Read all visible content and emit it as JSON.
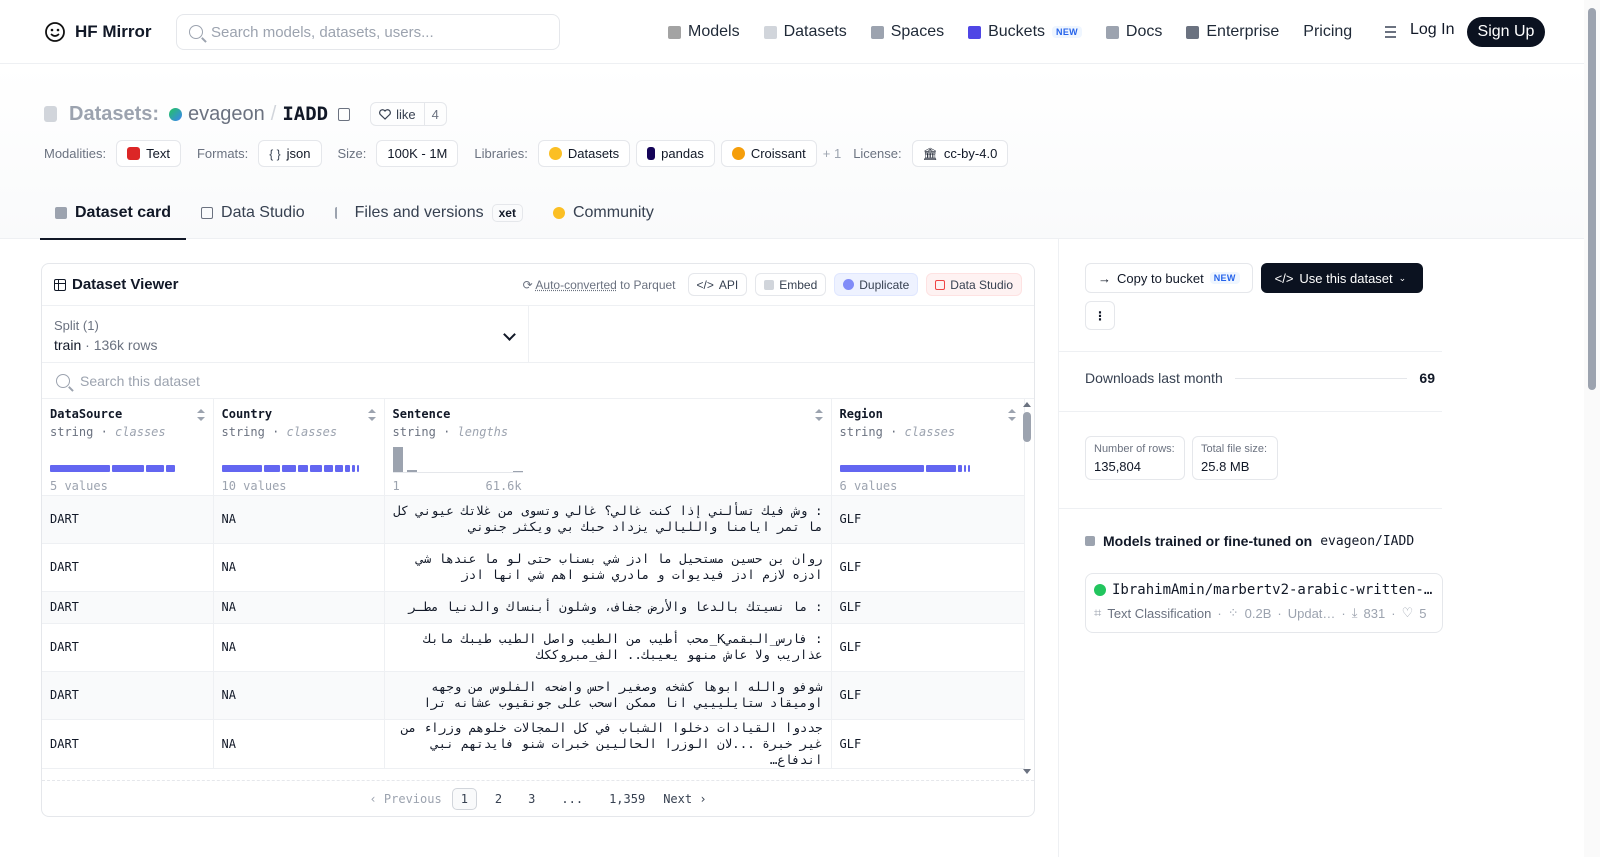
{
  "brand": {
    "name": "HF Mirror"
  },
  "search": {
    "placeholder": "Search models, datasets, users..."
  },
  "nav": {
    "items": [
      {
        "label": "Models",
        "icon": "cube-icon",
        "color": "#a3a3a3"
      },
      {
        "label": "Datasets",
        "icon": "database-icon",
        "color": "#d1d5db"
      },
      {
        "label": "Spaces",
        "icon": "grid-icon",
        "color": "#9ca3af"
      },
      {
        "label": "Buckets",
        "icon": "bucket-icon",
        "color": "#4f46e5",
        "badge": "NEW"
      },
      {
        "label": "Docs",
        "icon": "book-icon",
        "color": "#9ca3af"
      },
      {
        "label": "Enterprise",
        "icon": "enterprise-icon",
        "color": "#6b7280"
      },
      {
        "label": "Pricing"
      }
    ],
    "login": "Log In",
    "signup": "Sign Up"
  },
  "repo": {
    "type_label": "Datasets:",
    "owner": "evageon",
    "sep": "/",
    "name": "IADD",
    "like_label": "like",
    "like_count": "4"
  },
  "meta": {
    "modalities_label": "Modalities:",
    "modalities": [
      "Text"
    ],
    "formats_label": "Formats:",
    "formats": [
      "json"
    ],
    "size_label": "Size:",
    "size": "100K - 1M",
    "libraries_label": "Libraries:",
    "libraries": [
      "Datasets",
      "pandas",
      "Croissant"
    ],
    "libraries_more": "+ 1",
    "license_label": "License:",
    "license": "cc-by-4.0"
  },
  "tabs": [
    {
      "label": "Dataset card",
      "active": true
    },
    {
      "label": "Data Studio"
    },
    {
      "label": "Files and versions",
      "badge": "xet"
    },
    {
      "label": "Community"
    }
  ],
  "viewer": {
    "title": "Dataset Viewer",
    "auto_converted": "Auto-converted",
    "to_parquet": "to Parquet",
    "actions": [
      "API",
      "Embed",
      "Duplicate",
      "Data Studio"
    ],
    "split_label": "Split (1)",
    "split_value": "train",
    "split_rows": "136k rows",
    "search_placeholder": "Search this dataset",
    "columns": [
      {
        "name": "DataSource",
        "type": "string",
        "kind": "classes",
        "summary": "5 values"
      },
      {
        "name": "Country",
        "type": "string",
        "kind": "classes",
        "summary": "10 values"
      },
      {
        "name": "Sentence",
        "type": "string",
        "kind": "lengths",
        "min": "1",
        "max": "61.6k"
      },
      {
        "name": "Region",
        "type": "string",
        "kind": "classes",
        "summary": "6 values"
      }
    ],
    "rows": [
      {
        "source": "DART",
        "country": "NA",
        "sentence": ": وش فيك تسألني إذا كنت غالي؟ غالي وتسوى من غلاتك عيوني كل ما تمر ايامنا والليالي يزداد حبك بي ويكثر جنوني",
        "region": "GLF"
      },
      {
        "source": "DART",
        "country": "NA",
        "sentence": "روان بن حسين مستحيل ما ادز شي بسناب حتى لو ما عندها شي ادزه لازم ادز فيديوات و مادري شنو اهم شي انها ادز",
        "region": "GLF"
      },
      {
        "source": "DART",
        "country": "NA",
        "sentence": ": ما نسيتك بالدعا والأرض جفاف، وشلون أبنساك والدنيا مطـر",
        "region": "GLF"
      },
      {
        "source": "DART",
        "country": "NA",
        "sentence": ": فارس_البقميK_محب أطيب من الطيب واصل الطيب طيبك مابك عذاريب ولا عاش منهو يعيبك.. الف_مبروككك",
        "region": "GLF"
      },
      {
        "source": "DART",
        "country": "NA",
        "sentence": "شوفو والله ابوها كشخه وصغير احس واضحه الفلوس من وجهه اوميقاد ستايليييي انا ممكن اسحب على جونقيوب عشانه ترا",
        "region": "GLF"
      },
      {
        "source": "DART",
        "country": "NA",
        "sentence": "جددوا القيادات دخلوا الشباب في كل المجالات خلوهم وزراء من غير خبرة ...لان الوزرا الحاليين خبرات شنو فايدتهم نبي اندفاع…",
        "region": "GLF"
      }
    ],
    "pager": {
      "prev": "Previous",
      "pages": [
        "1",
        "2",
        "3",
        "...",
        "1,359"
      ],
      "current": "1",
      "next": "Next"
    }
  },
  "sidebar": {
    "copy_bucket": "Copy to bucket",
    "copy_badge": "NEW",
    "use_dataset": "Use this dataset",
    "downloads_label": "Downloads last month",
    "downloads_value": "69",
    "rows_label": "Number of rows:",
    "rows_value": "135,804",
    "size_label": "Total file size:",
    "size_value": "25.8 MB",
    "models_title": "Models trained or fine-tuned on",
    "models_repo": "evageon/IADD",
    "model": {
      "name": "IbrahimAmin/marbertv2-arabic-written-…",
      "task": "Text Classification",
      "params": "0.2B",
      "updated": "Updat…",
      "downloads": "831",
      "likes": "5"
    }
  }
}
